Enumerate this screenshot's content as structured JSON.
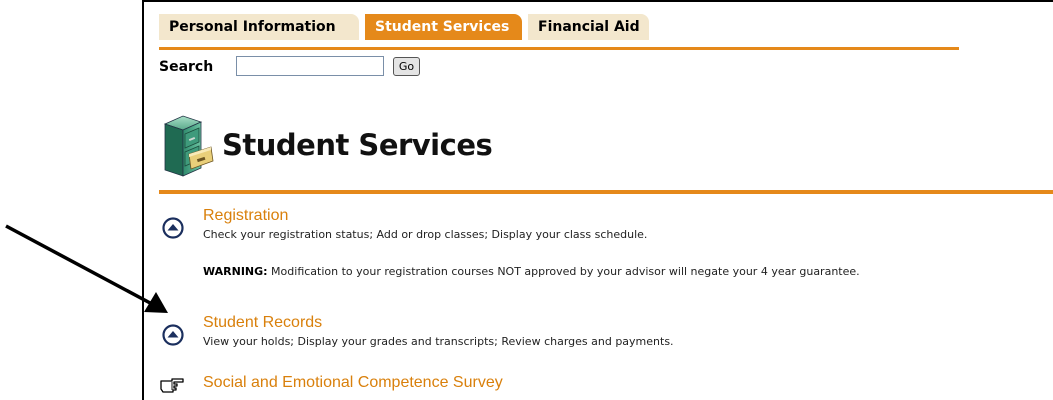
{
  "tabs": [
    {
      "label": "Personal Information",
      "active": false
    },
    {
      "label": "Student Services",
      "active": true
    },
    {
      "label": "Financial Aid",
      "active": false
    }
  ],
  "search": {
    "label": "Search",
    "value": "",
    "button_label": "Go"
  },
  "page": {
    "title": "Student Services",
    "icon": "file-cabinet-icon"
  },
  "menu": {
    "registration": {
      "title": "Registration",
      "description": "Check your registration status; Add or drop classes; Display your class schedule.",
      "icon": "circle-up-arrow-icon"
    },
    "warning": {
      "label": "WARNING:",
      "text": " Modification to your registration courses NOT approved by your advisor will negate your 4 year guarantee."
    },
    "student_records": {
      "title": "Student Records",
      "description": "View your holds; Display your grades and transcripts; Review charges and payments.",
      "icon": "circle-up-arrow-icon"
    },
    "survey": {
      "title": "Social and Emotional Competence Survey",
      "icon": "pointing-hand-icon"
    }
  },
  "colors": {
    "accent_orange": "#e5891a",
    "tab_inactive": "#f3e7cd",
    "link_orange": "#d9800c",
    "icon_navy": "#1b2f5e"
  },
  "annotation": {
    "icon": "arrow-pointer-icon"
  }
}
